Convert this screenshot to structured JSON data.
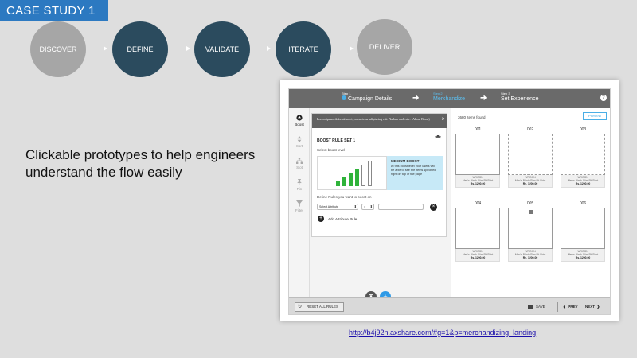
{
  "slide": {
    "tag": "CASE STUDY 1",
    "headline": "Clickable prototypes to help engineers understand the flow easily",
    "link": "http://b4j92n.axshare.com/#g=1&p=merchandizing_landing"
  },
  "process": {
    "steps": [
      {
        "label": "DISCOVER",
        "state": "todo"
      },
      {
        "label": "DEFINE",
        "state": "done"
      },
      {
        "label": "VALIDATE",
        "state": "done"
      },
      {
        "label": "ITERATE",
        "state": "done"
      },
      {
        "label": "DELIVER",
        "state": "todo"
      }
    ],
    "colors": {
      "done": "#2b4b5e",
      "todo": "#a6a6a6"
    }
  },
  "app": {
    "wizard": [
      {
        "num": "Step 1",
        "title": "Campaign Details",
        "state": "completed"
      },
      {
        "num": "Step 2",
        "title": "Merchandize",
        "state": "active"
      },
      {
        "num": "Step 3",
        "title": "Set Experience",
        "state": "upcoming"
      }
    ],
    "tools": [
      "Boost",
      "Sort",
      "Slot",
      "Pin",
      "Filter"
    ],
    "tooltip": {
      "text": "Lorem ipsum dolor sit amet, consectetur adipiscing elit. Nullam molestie. (About Boost)",
      "close": "x"
    },
    "rule": {
      "title": "BOOST RULE SET 1",
      "select_level_label": "Select boost level",
      "level_title": "MEDIUM BOOST",
      "level_text": "At this boost level your users will be able to see the items specified right on top of the page",
      "boost_level": "4 of 7",
      "define_label": "Define Rules you want to boost on",
      "attribute_placeholder": "Select Attribute",
      "operator": "=",
      "add_label": "Add Attribute Rule"
    },
    "results": {
      "count": "3680 items found",
      "preview": "Preview",
      "items": [
        {
          "num": "001",
          "brand": "WROGN",
          "name": "Men's Black Slim Fit Shirt",
          "price": "Rs. 1200.00",
          "style": "solid"
        },
        {
          "num": "002",
          "brand": "WROGN",
          "name": "Men's Black Slim Fit Shirt",
          "price": "Rs. 1200.00",
          "style": "dashed"
        },
        {
          "num": "003",
          "brand": "WROGN",
          "name": "Men's Black Slim Fit Shirt",
          "price": "Rs. 1200.00",
          "style": "dashed"
        },
        {
          "num": "004",
          "brand": "WROGN",
          "name": "Men's Black Slim Fit Shirt",
          "price": "Rs. 1200.00",
          "style": "solid"
        },
        {
          "num": "005",
          "brand": "WROGN",
          "name": "Men's Black Slim Fit Shirt",
          "price": "Rs. 1200.00",
          "style": "solid-pinned"
        },
        {
          "num": "006",
          "brand": "WROGN",
          "name": "Men's Black Slim Fit Shirt",
          "price": "Rs. 1200.00",
          "style": "solid"
        }
      ]
    },
    "footer": {
      "reset": "RESET ALL RULES",
      "save": "SAVE",
      "prev": "PREV",
      "next": "NEXT"
    },
    "colors": {
      "accent": "#4aaee6",
      "bar_green": "#2fb33a"
    }
  }
}
